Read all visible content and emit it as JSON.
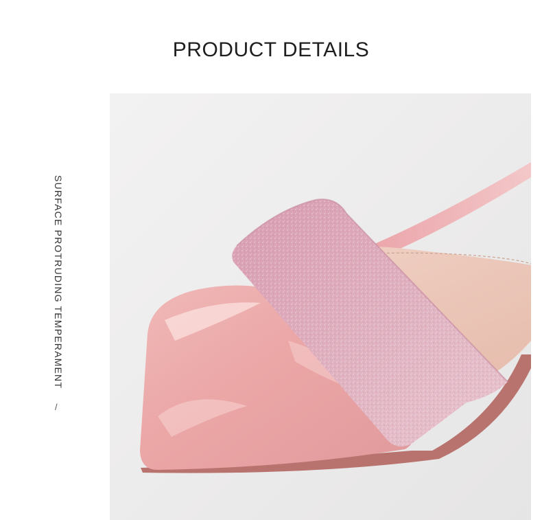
{
  "header": {
    "title": "PRODUCT DETAILS"
  },
  "side": {
    "caption": "SURFACE PROTRUDING TEMPERAMENT",
    "slash": "/"
  },
  "photo": {
    "subject": "pink-sandal-closeup",
    "colors": {
      "background": "#ecebeb",
      "patent_toe": "#eaa6a8",
      "glitter_strap": "#d8a6b6",
      "insole": "#e9c3b4"
    }
  }
}
